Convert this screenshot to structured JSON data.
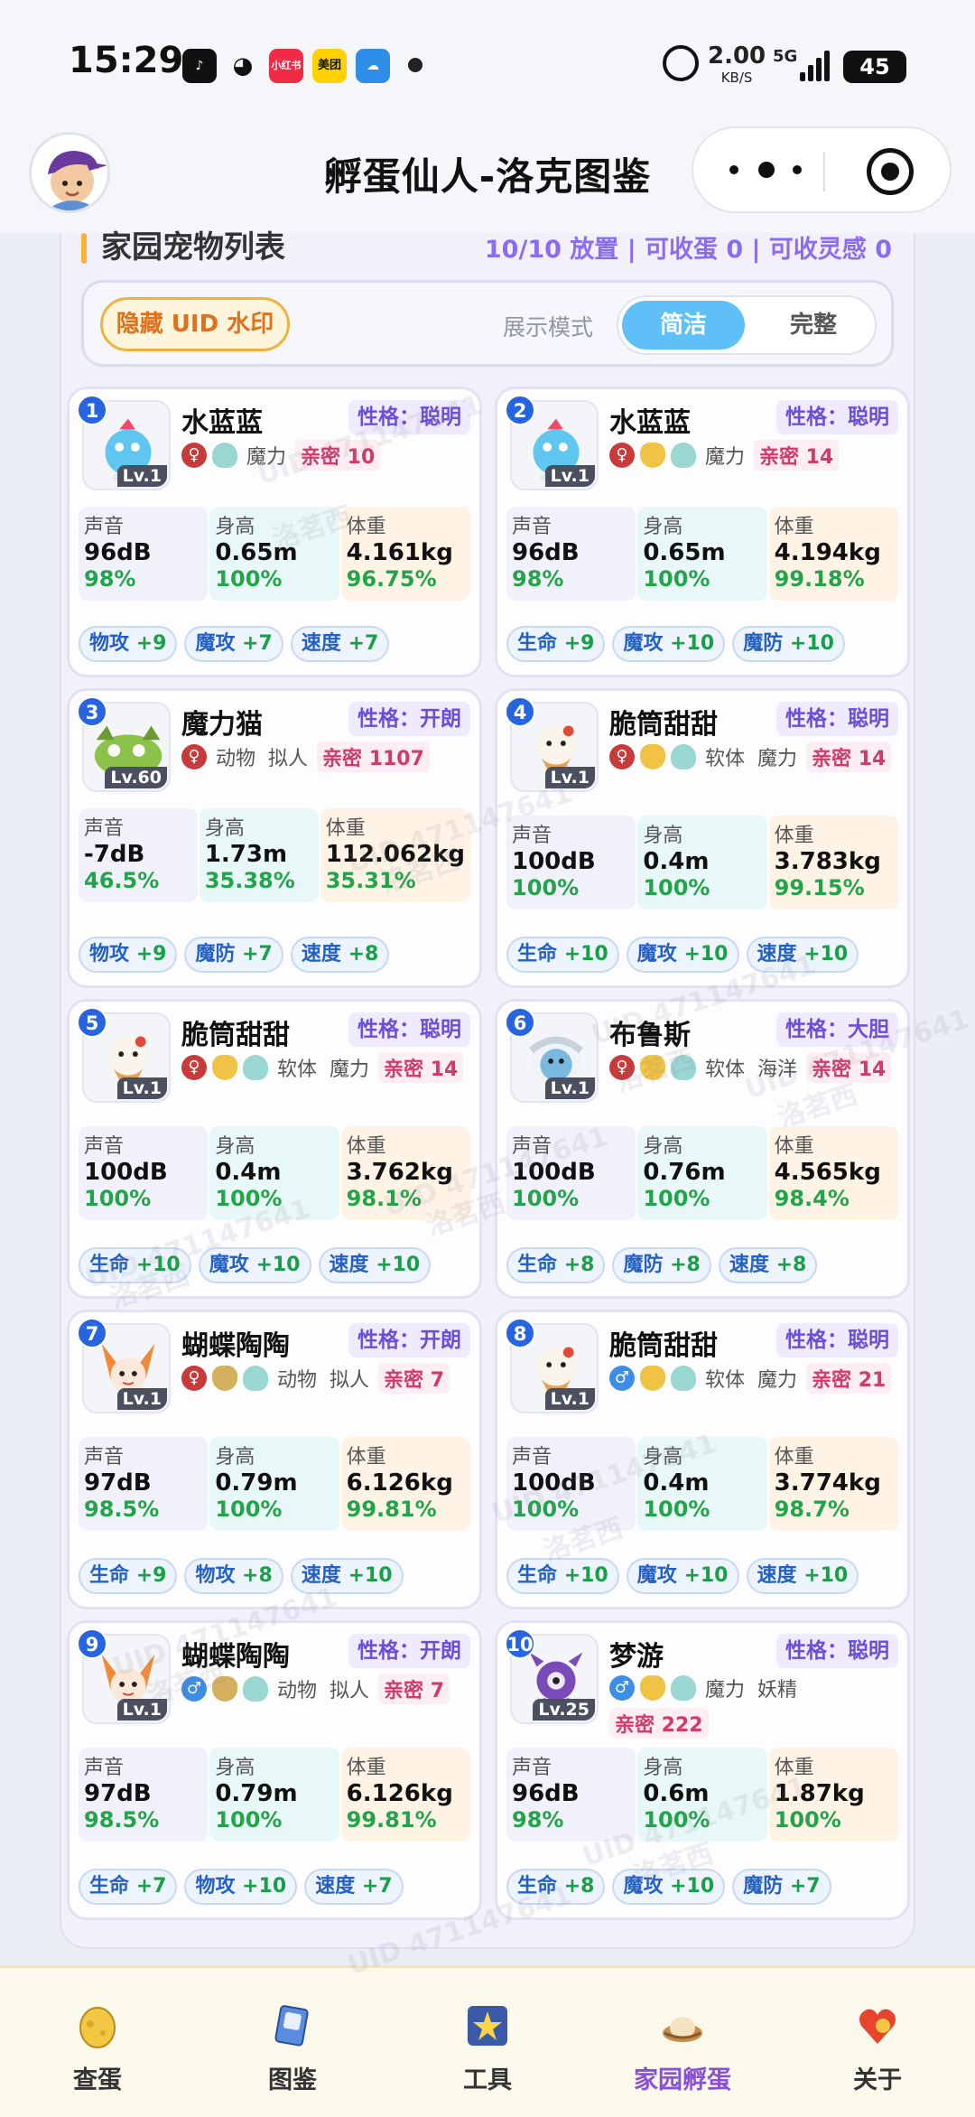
{
  "status_bar": {
    "time": "15:29",
    "apps": [
      "tiktok-icon",
      "qq-icon",
      "xiaohongshu-icon",
      "meituan-icon",
      "weather-icon"
    ],
    "app_labels": [
      "",
      "",
      "小红书",
      "美团",
      ""
    ],
    "speed_value": "2.00",
    "speed_unit": "KB/S",
    "network": "5G",
    "battery": "45"
  },
  "header": {
    "title": "孵蛋仙人-洛克图鉴"
  },
  "section": {
    "title": "家园宠物列表",
    "stats": "10/10 放置 | 可收蛋 0 | 可收灵感 0"
  },
  "filter": {
    "uid_button": "隐藏 UID 水印",
    "mode_label": "展示模式",
    "mode_simple": "简洁",
    "mode_full": "完整"
  },
  "stat_labels": {
    "sound": "声音",
    "height": "身高",
    "weight": "体重"
  },
  "pets": [
    {
      "num": "1",
      "name": "水蓝蓝",
      "nature": "性格：聪明",
      "level": "Lv.1",
      "gender": "female",
      "eggs": [
        "egg3"
      ],
      "tags": [
        "魔力"
      ],
      "intimacy": "亲密 10",
      "sound": "96dB",
      "sound_pct": "98%",
      "height": "0.65m",
      "height_pct": "100%",
      "weight": "4.161kg",
      "weight_pct": "96.75%",
      "bonuses": [
        [
          "物攻",
          "+9"
        ],
        [
          "魔攻",
          "+7"
        ],
        [
          "速度",
          "+7"
        ]
      ]
    },
    {
      "num": "2",
      "name": "水蓝蓝",
      "nature": "性格：聪明",
      "level": "Lv.1",
      "gender": "female",
      "eggs": [
        "egg1",
        "egg3"
      ],
      "tags": [
        "魔力"
      ],
      "intimacy": "亲密 14",
      "sound": "96dB",
      "sound_pct": "98%",
      "height": "0.65m",
      "height_pct": "100%",
      "weight": "4.194kg",
      "weight_pct": "99.18%",
      "bonuses": [
        [
          "生命",
          "+9"
        ],
        [
          "魔攻",
          "+10"
        ],
        [
          "魔防",
          "+10"
        ]
      ]
    },
    {
      "num": "3",
      "name": "魔力猫",
      "nature": "性格：开朗",
      "level": "Lv.60",
      "gender": "female",
      "eggs": [],
      "tags": [
        "动物",
        "拟人"
      ],
      "intimacy": "亲密 1107",
      "sound": "-7dB",
      "sound_pct": "46.5%",
      "height": "1.73m",
      "height_pct": "35.38%",
      "weight": "112.062kg",
      "weight_pct": "35.31%",
      "bonuses": [
        [
          "物攻",
          "+9"
        ],
        [
          "魔防",
          "+7"
        ],
        [
          "速度",
          "+8"
        ]
      ]
    },
    {
      "num": "4",
      "name": "脆筒甜甜",
      "nature": "性格：聪明",
      "level": "Lv.1",
      "gender": "female",
      "eggs": [
        "egg1",
        "egg3"
      ],
      "tags": [
        "软体",
        "魔力"
      ],
      "intimacy": "亲密 14",
      "sound": "100dB",
      "sound_pct": "100%",
      "height": "0.4m",
      "height_pct": "100%",
      "weight": "3.783kg",
      "weight_pct": "99.15%",
      "bonuses": [
        [
          "生命",
          "+10"
        ],
        [
          "魔攻",
          "+10"
        ],
        [
          "速度",
          "+10"
        ]
      ]
    },
    {
      "num": "5",
      "name": "脆筒甜甜",
      "nature": "性格：聪明",
      "level": "Lv.1",
      "gender": "female",
      "eggs": [
        "egg1",
        "egg3"
      ],
      "tags": [
        "软体",
        "魔力"
      ],
      "intimacy": "亲密 14",
      "sound": "100dB",
      "sound_pct": "100%",
      "height": "0.4m",
      "height_pct": "100%",
      "weight": "3.762kg",
      "weight_pct": "98.1%",
      "bonuses": [
        [
          "生命",
          "+10"
        ],
        [
          "魔攻",
          "+10"
        ],
        [
          "速度",
          "+10"
        ]
      ]
    },
    {
      "num": "6",
      "name": "布鲁斯",
      "nature": "性格：大胆",
      "level": "Lv.1",
      "gender": "female",
      "eggs": [
        "egg1",
        "egg3"
      ],
      "tags": [
        "软体",
        "海洋"
      ],
      "intimacy": "亲密 14",
      "sound": "100dB",
      "sound_pct": "100%",
      "height": "0.76m",
      "height_pct": "100%",
      "weight": "4.565kg",
      "weight_pct": "98.4%",
      "bonuses": [
        [
          "生命",
          "+8"
        ],
        [
          "魔防",
          "+8"
        ],
        [
          "速度",
          "+8"
        ]
      ]
    },
    {
      "num": "7",
      "name": "蝴蝶陶陶",
      "nature": "性格：开朗",
      "level": "Lv.1",
      "gender": "female",
      "eggs": [
        "egg2",
        "egg3"
      ],
      "tags": [
        "动物",
        "拟人"
      ],
      "intimacy": "亲密 7",
      "sound": "97dB",
      "sound_pct": "98.5%",
      "height": "0.79m",
      "height_pct": "100%",
      "weight": "6.126kg",
      "weight_pct": "99.81%",
      "bonuses": [
        [
          "生命",
          "+9"
        ],
        [
          "物攻",
          "+8"
        ],
        [
          "速度",
          "+10"
        ]
      ]
    },
    {
      "num": "8",
      "name": "脆筒甜甜",
      "nature": "性格：聪明",
      "level": "Lv.1",
      "gender": "male",
      "eggs": [
        "egg1",
        "egg3"
      ],
      "tags": [
        "软体",
        "魔力"
      ],
      "intimacy": "亲密 21",
      "sound": "100dB",
      "sound_pct": "100%",
      "height": "0.4m",
      "height_pct": "100%",
      "weight": "3.774kg",
      "weight_pct": "98.7%",
      "bonuses": [
        [
          "生命",
          "+10"
        ],
        [
          "魔攻",
          "+10"
        ],
        [
          "速度",
          "+10"
        ]
      ]
    },
    {
      "num": "9",
      "name": "蝴蝶陶陶",
      "nature": "性格：开朗",
      "level": "Lv.1",
      "gender": "male",
      "eggs": [
        "egg2",
        "egg3"
      ],
      "tags": [
        "动物",
        "拟人"
      ],
      "intimacy": "亲密 7",
      "sound": "97dB",
      "sound_pct": "98.5%",
      "height": "0.79m",
      "height_pct": "100%",
      "weight": "6.126kg",
      "weight_pct": "99.81%",
      "bonuses": [
        [
          "生命",
          "+7"
        ],
        [
          "物攻",
          "+10"
        ],
        [
          "速度",
          "+7"
        ]
      ]
    },
    {
      "num": "10",
      "name": "梦游",
      "nature": "性格：聪明",
      "level": "Lv.25",
      "gender": "male",
      "eggs": [
        "egg1",
        "egg3"
      ],
      "tags": [
        "魔力",
        "妖精"
      ],
      "intimacy": "亲密 222",
      "sound": "96dB",
      "sound_pct": "98%",
      "height": "0.6m",
      "height_pct": "100%",
      "weight": "1.87kg",
      "weight_pct": "100%",
      "bonuses": [
        [
          "生命",
          "+8"
        ],
        [
          "魔攻",
          "+10"
        ],
        [
          "魔防",
          "+7"
        ]
      ]
    }
  ],
  "watermarks": [
    "UID 471147641",
    "洛茗西"
  ],
  "bottom_nav": [
    {
      "label": "查蛋",
      "icon": "egg-icon",
      "active": false
    },
    {
      "label": "图鉴",
      "icon": "card-icon",
      "active": false
    },
    {
      "label": "工具",
      "icon": "tools-icon",
      "active": false
    },
    {
      "label": "家园孵蛋",
      "icon": "nest-icon",
      "active": true
    },
    {
      "label": "关于",
      "icon": "heart-icon",
      "active": false
    }
  ],
  "colors": {
    "accent_purple": "#8a6cf0",
    "selected_blue": "#5fc0f7",
    "stat_green": "#24a44a",
    "intimacy_pink": "#d23a6a",
    "number_badge": "#2764e0"
  }
}
